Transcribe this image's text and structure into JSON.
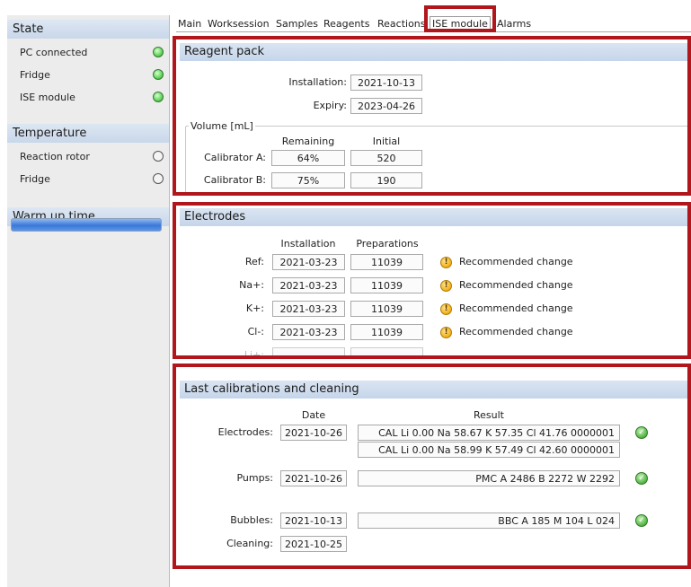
{
  "left": {
    "state": {
      "title": "State",
      "items": [
        {
          "label": "PC connected",
          "status": "on"
        },
        {
          "label": "Fridge",
          "status": "on"
        },
        {
          "label": "ISE module",
          "status": "on"
        }
      ]
    },
    "temperature": {
      "title": "Temperature",
      "items": [
        {
          "label": "Reaction rotor",
          "status": "off"
        },
        {
          "label": "Fridge",
          "status": "off"
        }
      ]
    },
    "warmup": {
      "title": "Warm up time",
      "progress": 1.0
    }
  },
  "tabs": [
    "Main",
    "Worksession",
    "Samples",
    "Reagents",
    "Reactions",
    "ISE module",
    "Alarms"
  ],
  "active_tab": "ISE module",
  "reagent_pack": {
    "title": "Reagent pack",
    "installation_label": "Installation:",
    "installation": "2021-10-13",
    "expiry_label": "Expiry:",
    "expiry": "2023-04-26",
    "volume_legend": "Volume [mL]",
    "col_remaining": "Remaining",
    "col_initial": "Initial",
    "rows": [
      {
        "label": "Calibrator A:",
        "remaining": "64%",
        "initial": "520"
      },
      {
        "label": "Calibrator B:",
        "remaining": "75%",
        "initial": "190"
      }
    ]
  },
  "electrodes": {
    "title": "Electrodes",
    "col_installation": "Installation",
    "col_preparations": "Preparations",
    "rows": [
      {
        "label": "Ref:",
        "installation": "2021-03-23",
        "preparations": "11039",
        "status": "Recommended change"
      },
      {
        "label": "Na+:",
        "installation": "2021-03-23",
        "preparations": "11039",
        "status": "Recommended change"
      },
      {
        "label": "K+:",
        "installation": "2021-03-23",
        "preparations": "11039",
        "status": "Recommended change"
      },
      {
        "label": "Cl-:",
        "installation": "2021-03-23",
        "preparations": "11039",
        "status": "Recommended change"
      }
    ],
    "partial_label": "Li+:"
  },
  "calibrations": {
    "title": "Last calibrations and cleaning",
    "col_date": "Date",
    "col_result": "Result",
    "electrodes": {
      "label": "Electrodes:",
      "date": "2021-10-26",
      "results": [
        "CAL Li  0.00 Na 58.67 K 57.35 Cl 41.76 0000001",
        "CAL Li  0.00 Na 58.99 K 57.49 Cl 42.60 0000001"
      ]
    },
    "pumps": {
      "label": "Pumps:",
      "date": "2021-10-26",
      "result": "PMC A 2486 B 2272 W 2292"
    },
    "bubbles": {
      "label": "Bubbles:",
      "date": "2021-10-13",
      "result": "BBC A 185 M 104 L 024"
    },
    "cleaning": {
      "label": "Cleaning:",
      "date": "2021-10-25"
    }
  },
  "colors": {
    "highlight": "#b0161b",
    "header": "#c9d7ea",
    "led_on": "#5fd65a",
    "warn": "#f2b21b",
    "ok": "#58b94a"
  }
}
